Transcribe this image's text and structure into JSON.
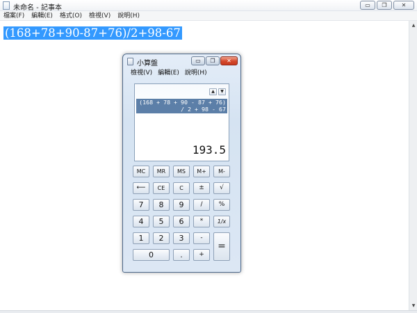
{
  "notepad": {
    "title": "未命名 - 記事本",
    "window_controls": {
      "minimize": "▭",
      "restore": "❐",
      "close": "✕"
    },
    "menu": [
      "檔案(F)",
      "編輯(E)",
      "格式(O)",
      "檢視(V)",
      "說明(H)"
    ],
    "text": "(168+78+90-87+76)/2+98-67",
    "scroll_up": "▲",
    "scroll_down": "▼"
  },
  "calculator": {
    "title": "小算盤",
    "window_controls": {
      "minimize": "▭",
      "restore": "❐",
      "close": "✕"
    },
    "menu": [
      "檢視(V)",
      "編輯(E)",
      "說明(H)"
    ],
    "history_up": "▲",
    "history_down": "▼",
    "expression_line1": "(168 + 78 + 90 - 87 + 76)",
    "expression_line2": "/ 2 + 98 - 67",
    "result": "193.5",
    "keys": {
      "mc": "MC",
      "mr": "MR",
      "ms": "MS",
      "mplus": "M+",
      "mminus": "M-",
      "backspace": "⟵",
      "ce": "CE",
      "c": "C",
      "plusminus": "±",
      "sqrt": "√",
      "n7": "7",
      "n8": "8",
      "n9": "9",
      "divide": "/",
      "percent": "%",
      "n4": "4",
      "n5": "5",
      "n6": "6",
      "multiply": "*",
      "reciprocal": "1/x",
      "n1": "1",
      "n2": "2",
      "n3": "3",
      "minus": "-",
      "equals": "=",
      "n0": "0",
      "decimal": ".",
      "plus": "+"
    }
  },
  "colors": {
    "selection": "#3399ff",
    "calc_expression_bg": "#5c7fa8",
    "calc_close": "#d4482b"
  }
}
